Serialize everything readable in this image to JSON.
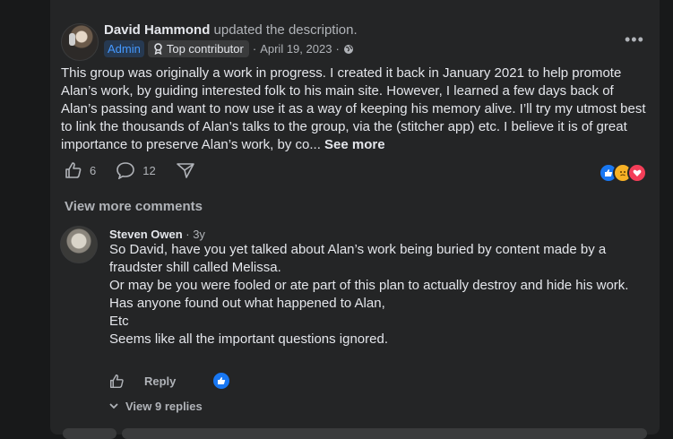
{
  "post": {
    "author": "David Hammond",
    "action": "updated the description.",
    "badge_admin": "Admin",
    "badge_top": "Top contributor",
    "date": "April 19, 2023",
    "separator": "·",
    "text": "This group was originally a work in progress. I created it back in January 2021 to help promote Alan’s work, by guiding interested folk to his main site. However, I learned a few days back of Alan’s passing and want to now use it as a way of keeping his memory alive. I’ll try my utmost best to link the thousands of Alan’s talks to the group, via the (stitcher app) etc. I believe it is of great importance to preserve Alan’s work, by co...",
    "see_more": "See more",
    "like_count": "6",
    "comment_count": "12",
    "reactions": [
      "like-icon",
      "sad-icon",
      "love-icon"
    ]
  },
  "comments": {
    "view_more": "View more comments",
    "item": {
      "author": "Steven Owen",
      "time": "· 3y",
      "lines": [
        "So David, have you yet talked about Alan’s work being buried by content made by a fraudster shill called Melissa.",
        "Or may be you were fooled or ate part of this plan to actually destroy and hide his work.",
        "Has anyone found out what happened to Alan,",
        "Etc",
        "Seems like all the important questions ignored."
      ],
      "reply_label": "Reply",
      "view_replies": "View 9 replies"
    }
  },
  "colors": {
    "background": "#18191a",
    "card": "#242526",
    "primary_text": "#e4e6eb",
    "secondary_text": "#b0b3b8",
    "admin_blue": "#4599ff",
    "like_blue": "#1877f2"
  }
}
